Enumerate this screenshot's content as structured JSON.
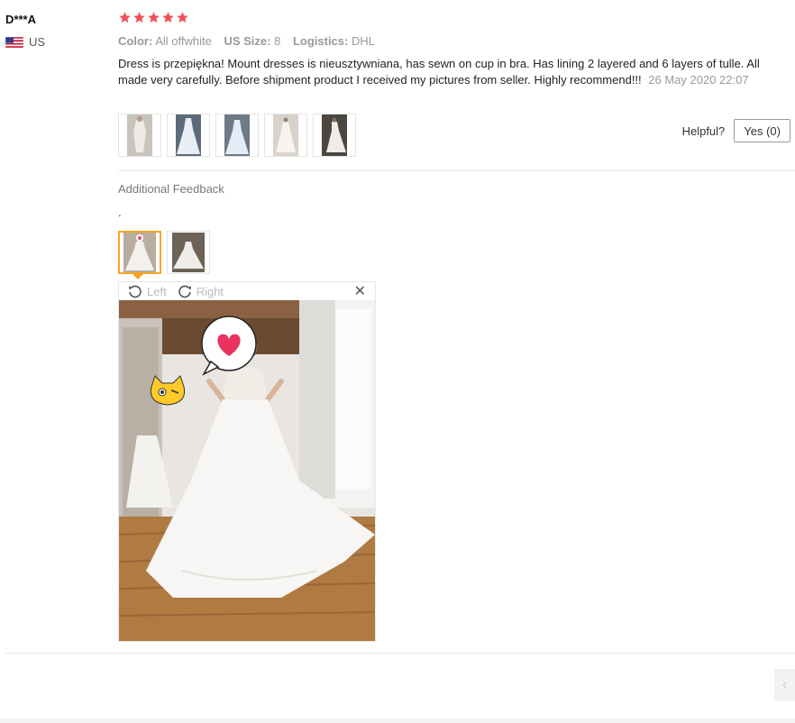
{
  "reviewer": {
    "name": "D***A",
    "country_code": "US",
    "flag": "us-flag-icon"
  },
  "rating": {
    "value": 5,
    "max": 5,
    "star_color": "#f0505a"
  },
  "attributes": [
    {
      "key": "Color:",
      "value": "All offwhite"
    },
    {
      "key": "US Size:",
      "value": "8"
    },
    {
      "key": "Logistics:",
      "value": "DHL"
    }
  ],
  "review": {
    "text": "Dress is przepiękna! Mount dresses is nieusztywniana, has sewn on cup in bra. Has lining 2 layered and 6 layers of tulle. All made very carefully. Before shipment product I received my pictures from seller. Highly recommend!!!",
    "date": "26 May 2020 22:07"
  },
  "helpful": {
    "label": "Helpful?",
    "button_label": "Yes (0)"
  },
  "additional": {
    "title": "Additional Feedback",
    "text": "."
  },
  "viewer": {
    "left_label": "Left",
    "right_label": "Right",
    "close_label": "✕"
  },
  "side_tab": {
    "label": "‹"
  },
  "colors": {
    "accent": "#f5a623",
    "muted": "#999999",
    "border": "#e5e5e5"
  }
}
